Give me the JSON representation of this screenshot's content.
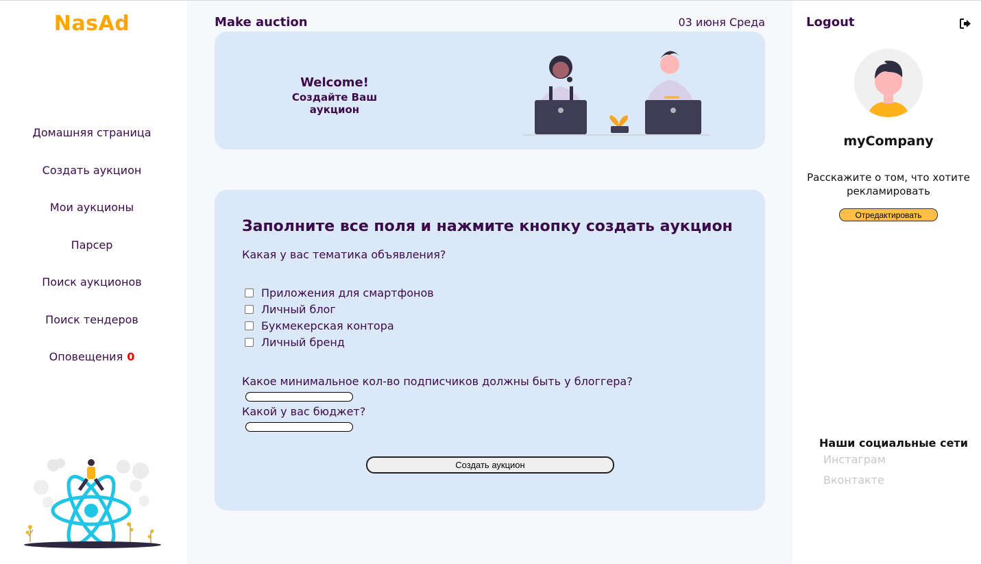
{
  "sidebar": {
    "logo": "NasAd",
    "items": [
      {
        "label": "Домашняя страница"
      },
      {
        "label": "Создать аукцион"
      },
      {
        "label": "Мои аукционы"
      },
      {
        "label": "Парсер"
      },
      {
        "label": "Поиск аукционов"
      },
      {
        "label": "Поиск тендеров"
      },
      {
        "label": "Оповещения",
        "count": "0"
      }
    ]
  },
  "header": {
    "title": "Make auction",
    "date": "03 июня Среда"
  },
  "welcome": {
    "title": "Welcome!",
    "subtitle": "Создайте Ваш аукцион"
  },
  "form": {
    "heading": "Заполните все поля и нажмите кнопку создать аукцион",
    "topic_question": "Какая у вас тематика объявления?",
    "topics": [
      {
        "label": "Приложения для смартфонов",
        "checked": false
      },
      {
        "label": "Личный блог",
        "checked": false
      },
      {
        "label": "Букмекерская контора",
        "checked": false
      },
      {
        "label": "Личный бренд",
        "checked": false
      }
    ],
    "subscribers_question": "Какое минимальное кол-во подписчиков должны быть у блоггера?",
    "subscribers_value": "",
    "budget_question": "Какой у вас бюджет?",
    "budget_value": "",
    "submit_label": "Создать аукцион"
  },
  "profile": {
    "logout_label": "Logout",
    "company": "myCompany",
    "about": "Расскажите о том, что хотите рекламировать",
    "edit_label": "Отредактировать"
  },
  "social": {
    "title": "Наши социальные сети",
    "links": [
      {
        "label": "Инстаграм"
      },
      {
        "label": "Вконтакте"
      }
    ]
  },
  "colors": {
    "brand": "#ffa500",
    "text": "#3a0a4a",
    "card": "#dbe8f8",
    "notification": "#ee0000",
    "edit_button": "#ffbf47"
  }
}
